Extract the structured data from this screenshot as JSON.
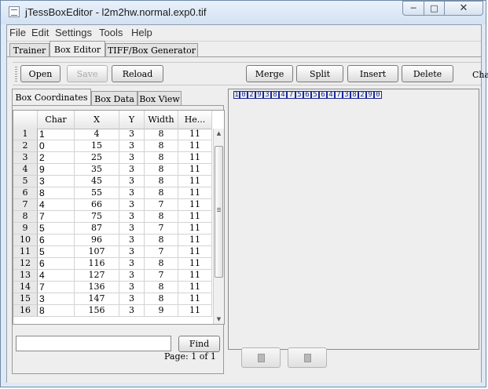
{
  "window": {
    "title": "jTessBoxEditor - l2m2hw.normal.exp0.tif"
  },
  "menu": [
    "File",
    "Edit",
    "Settings",
    "Tools",
    "Help"
  ],
  "main_tabs": [
    {
      "label": "Trainer"
    },
    {
      "label": "Box Editor"
    },
    {
      "label": "TIFF/Box Generator"
    }
  ],
  "toolbar": {
    "open": "Open",
    "save": "Save",
    "reload": "Reload",
    "merge": "Merge",
    "split": "Split",
    "insert": "Insert",
    "delete": "Delete",
    "char_label": "Cha"
  },
  "sub_tabs": [
    {
      "label": "Box Coordinates"
    },
    {
      "label": "Box Data"
    },
    {
      "label": "Box View"
    }
  ],
  "table": {
    "columns": [
      "Char",
      "X",
      "Y",
      "Width",
      "He..."
    ],
    "rows": [
      {
        "n": "1",
        "char": "1",
        "x": "4",
        "y": "3",
        "w": "8",
        "h": "11"
      },
      {
        "n": "2",
        "char": "0",
        "x": "15",
        "y": "3",
        "w": "8",
        "h": "11"
      },
      {
        "n": "3",
        "char": "2",
        "x": "25",
        "y": "3",
        "w": "8",
        "h": "11"
      },
      {
        "n": "4",
        "char": "9",
        "x": "35",
        "y": "3",
        "w": "8",
        "h": "11"
      },
      {
        "n": "5",
        "char": "3",
        "x": "45",
        "y": "3",
        "w": "8",
        "h": "11"
      },
      {
        "n": "6",
        "char": "8",
        "x": "55",
        "y": "3",
        "w": "8",
        "h": "11"
      },
      {
        "n": "7",
        "char": "4",
        "x": "66",
        "y": "3",
        "w": "7",
        "h": "11"
      },
      {
        "n": "8",
        "char": "7",
        "x": "75",
        "y": "3",
        "w": "8",
        "h": "11"
      },
      {
        "n": "9",
        "char": "5",
        "x": "87",
        "y": "3",
        "w": "7",
        "h": "11"
      },
      {
        "n": "10",
        "char": "6",
        "x": "96",
        "y": "3",
        "w": "8",
        "h": "11"
      },
      {
        "n": "11",
        "char": "5",
        "x": "107",
        "y": "3",
        "w": "7",
        "h": "11"
      },
      {
        "n": "12",
        "char": "6",
        "x": "116",
        "y": "3",
        "w": "8",
        "h": "11"
      },
      {
        "n": "13",
        "char": "4",
        "x": "127",
        "y": "3",
        "w": "7",
        "h": "11"
      },
      {
        "n": "14",
        "char": "7",
        "x": "136",
        "y": "3",
        "w": "8",
        "h": "11"
      },
      {
        "n": "15",
        "char": "3",
        "x": "147",
        "y": "3",
        "w": "8",
        "h": "11"
      },
      {
        "n": "16",
        "char": "8",
        "x": "156",
        "y": "3",
        "w": "9",
        "h": "11"
      }
    ]
  },
  "find": {
    "value": "",
    "button": "Find"
  },
  "image_text": "1029384756564738290",
  "pager": {
    "text": "Page: 1 of 1"
  },
  "icons": {
    "minimize": "minimize-icon",
    "maximize": "maximize-icon",
    "close": "close-icon",
    "prev": "prev-page-icon",
    "next": "next-page-icon"
  },
  "colors": {
    "glyph_box": "#1a2a9a",
    "title_bg": "#dfe9f5"
  }
}
